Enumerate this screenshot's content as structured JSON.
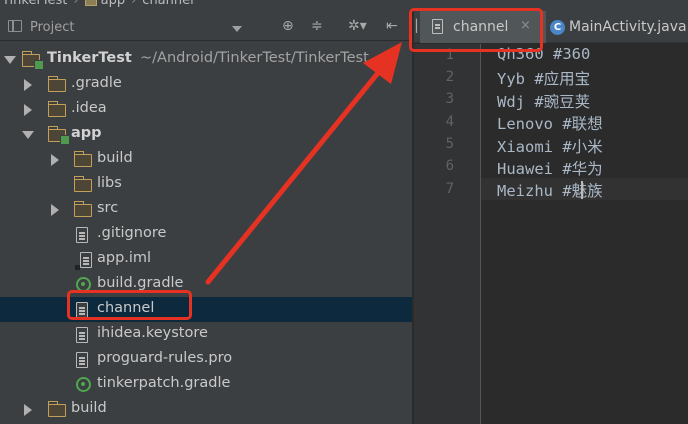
{
  "breadcrumb": {
    "items": [
      "TinkerTest",
      "app",
      "channel"
    ]
  },
  "project_panel": {
    "title": "Project",
    "tools": [
      "target-icon",
      "collapse-icon",
      "gear-icon",
      "hide-icon"
    ]
  },
  "tree": [
    {
      "label": "TinkerTest",
      "path": "~/Android/TinkerTest/TinkerTest",
      "icon": "module-folder-icon",
      "expanded": true
    },
    {
      "label": ".gradle",
      "icon": "folder-icon",
      "expanded": false
    },
    {
      "label": ".idea",
      "icon": "folder-icon",
      "expanded": false
    },
    {
      "label": "app",
      "icon": "module-folder-icon",
      "expanded": true
    },
    {
      "label": "build",
      "icon": "folder-icon",
      "expanded": false
    },
    {
      "label": "libs",
      "icon": "folder-icon"
    },
    {
      "label": "src",
      "icon": "folder-icon",
      "expanded": false
    },
    {
      "label": ".gitignore",
      "icon": "file-icon"
    },
    {
      "label": "app.iml",
      "icon": "iml-file-icon"
    },
    {
      "label": "build.gradle",
      "icon": "gradle-icon"
    },
    {
      "label": "channel",
      "icon": "file-icon",
      "selected": true
    },
    {
      "label": "ihidea.keystore",
      "icon": "file-icon"
    },
    {
      "label": "proguard-rules.pro",
      "icon": "file-icon"
    },
    {
      "label": "tinkerpatch.gradle",
      "icon": "gradle-icon"
    },
    {
      "label": "build",
      "icon": "folder-icon",
      "expanded": false
    }
  ],
  "tabs": [
    {
      "label": "channel",
      "icon": "file-icon",
      "active": true,
      "close": "×"
    },
    {
      "label": "MainActivity.java",
      "icon": "class-icon",
      "icon_text": "C",
      "active": false
    }
  ],
  "editor": {
    "line_numbers": [
      "1",
      "2",
      "3",
      "4",
      "5",
      "6",
      "7"
    ],
    "lines": [
      "Qh360 #360",
      "Yyb #应用宝",
      "Wdj #豌豆荚",
      "Lenovo #联想",
      "Xiaomi #小米",
      "Huawei #华为",
      "Meizhu #魅族"
    ]
  },
  "colors": {
    "highlight": "#e63222",
    "selection": "#0d293e",
    "background": "#2b2b2b",
    "panel": "#3c3f41"
  }
}
